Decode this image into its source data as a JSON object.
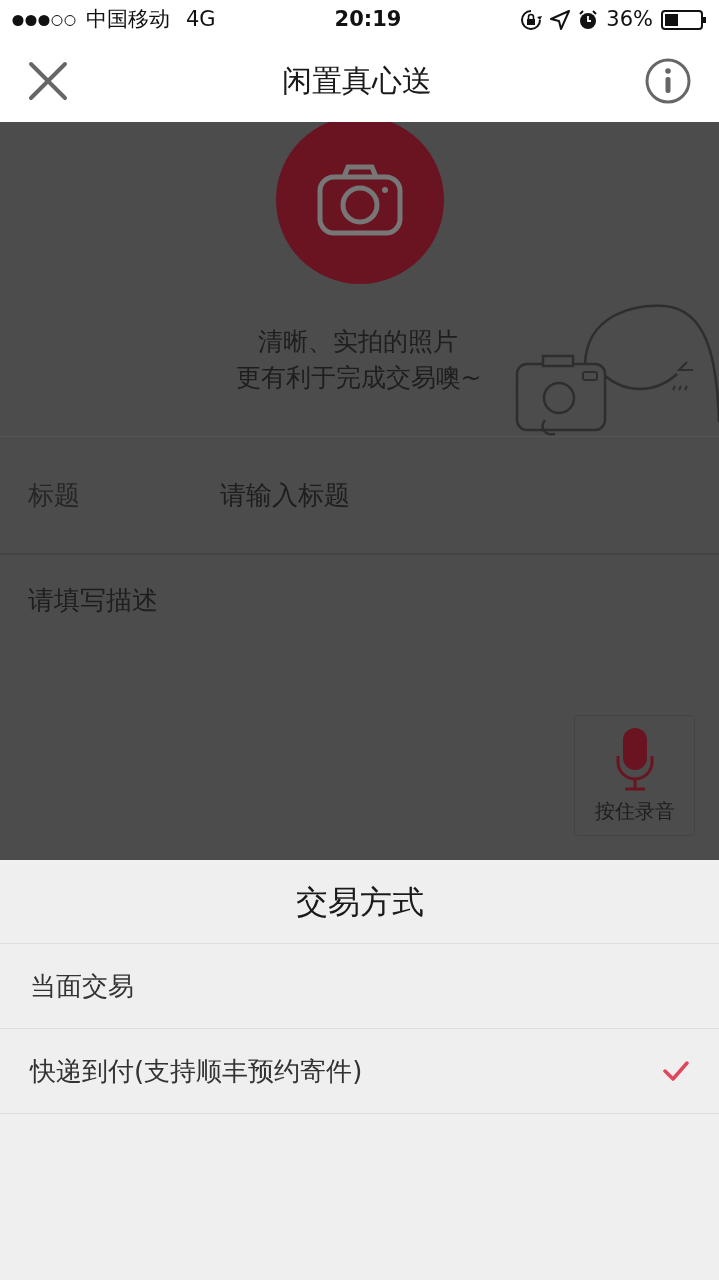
{
  "status_bar": {
    "carrier": "中国移动",
    "network": "4G",
    "time": "20:19",
    "battery": "36%"
  },
  "nav": {
    "title": "闲置真心送"
  },
  "photo": {
    "hint_lines": [
      "清晰、实拍的照片",
      "更有利于完成交易噢~"
    ]
  },
  "form": {
    "title_label": "标题",
    "title_placeholder": "请输入标题",
    "description_placeholder": "请填写描述",
    "voice_button": "按住录音"
  },
  "sheet": {
    "title": "交易方式",
    "options": [
      {
        "label": "当面交易",
        "selected": false
      },
      {
        "label": "快递到付(支持顺丰预约寄件)",
        "selected": true
      }
    ]
  }
}
